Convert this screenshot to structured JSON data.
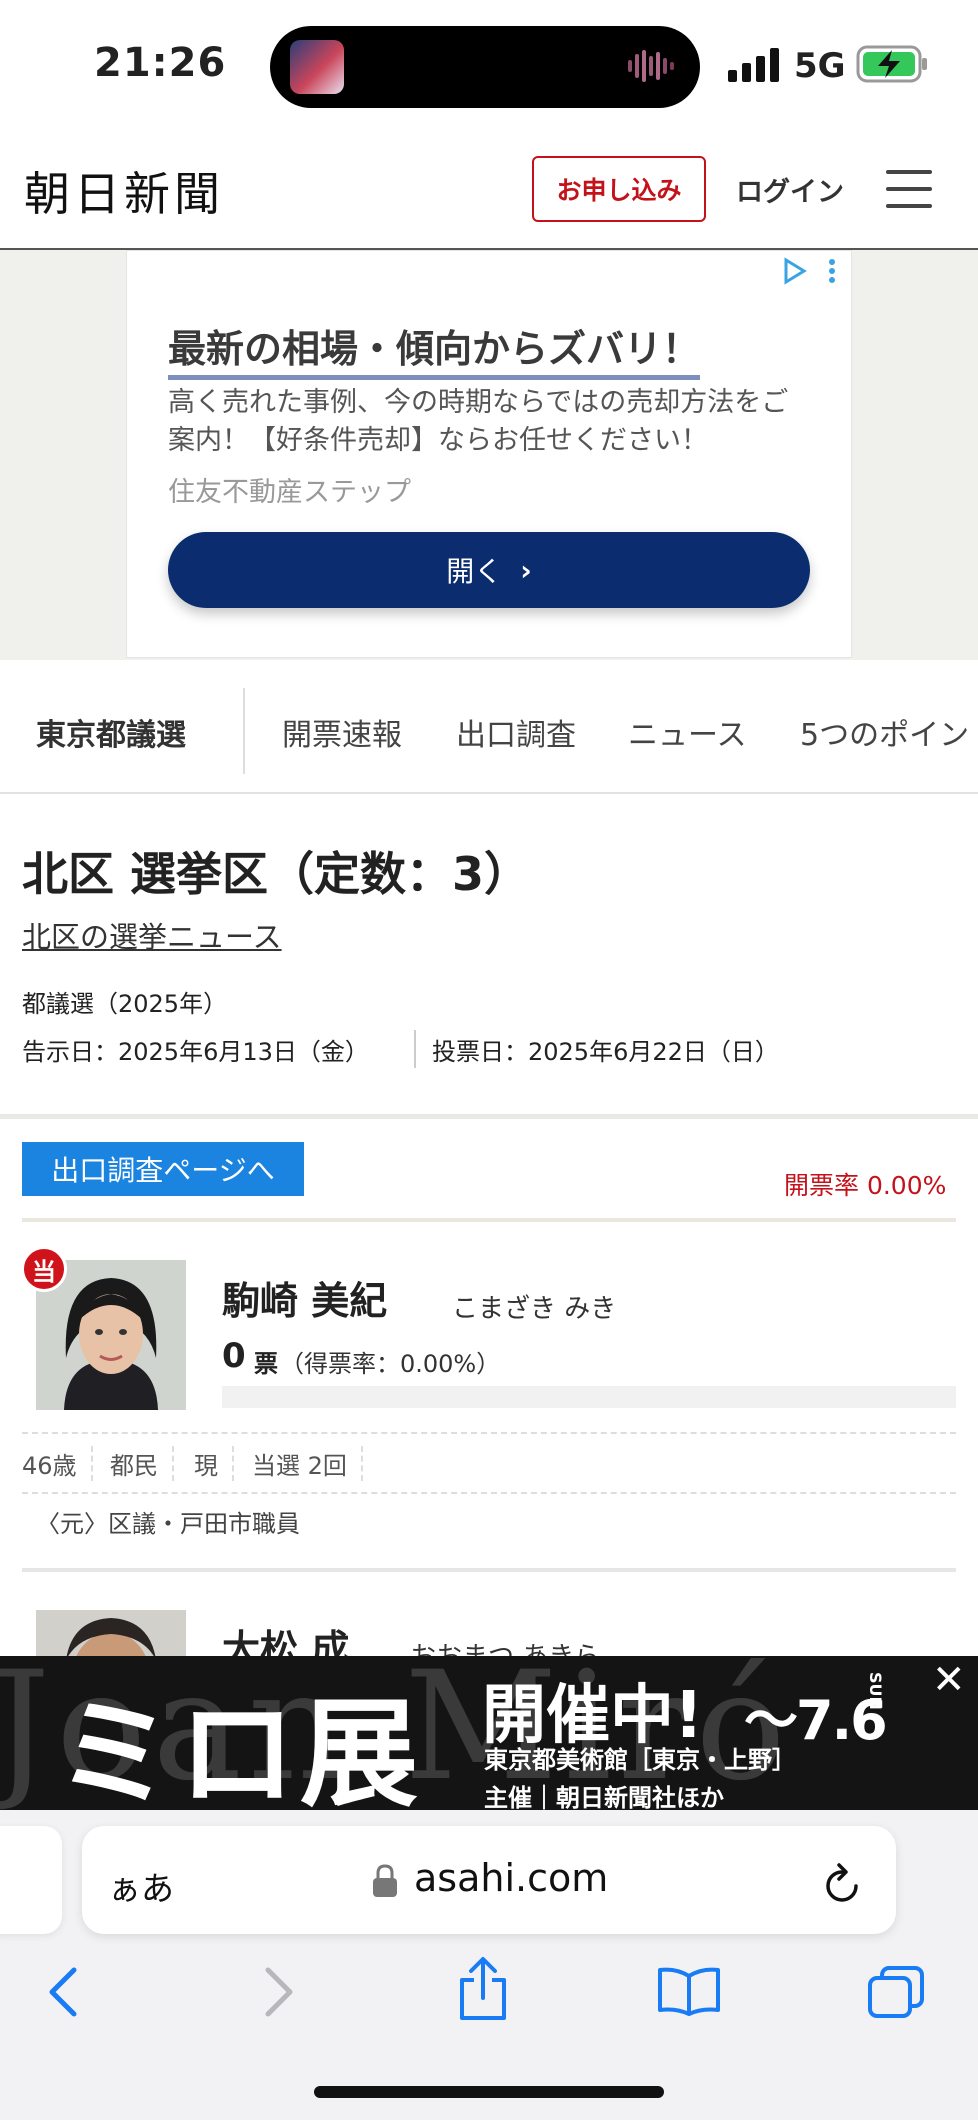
{
  "status_bar": {
    "time": "21:26",
    "network": "5G"
  },
  "header": {
    "logo": "朝日新聞",
    "subscribe_label": "お申し込み",
    "login_label": "ログイン"
  },
  "ad": {
    "headline": "最新の相場・傾向からズバリ！",
    "body": "高く売れた事例、今の時期ならではの売却方法をご案内！【好条件売却】ならお任せください！",
    "advertiser": "住友不動産ステップ",
    "button_label": "開く"
  },
  "election_nav": {
    "title": "東京都議選",
    "tabs": [
      "開票速報",
      "出口調査",
      "ニュース",
      "5つのポイン"
    ]
  },
  "district": {
    "title": "北区 選挙区（定数：3）",
    "news_link": "北区の選挙ニュース",
    "election": "都議選（2025年）",
    "notice_date": "告示日：2025年6月13日（金）",
    "vote_date": "投票日：2025年6月22日（日）"
  },
  "results": {
    "exit_poll_button": "出口調査ページへ",
    "turnout": "開票率 0.00%"
  },
  "candidates": [
    {
      "elected_badge": "当",
      "name": "駒崎 美紀",
      "kana": "こまざき みき",
      "votes": "0",
      "vote_unit": "票",
      "vote_rate": "（得票率：0.00%）",
      "vote_share": 0,
      "tags": [
        "46歳",
        "都民",
        "現",
        "当選 2回"
      ],
      "career": "〈元〉区議・戸田市職員"
    },
    {
      "name": "大松 成",
      "kana": "おおまつ あきら"
    }
  ],
  "banner_ad": {
    "background_letters": "Joan Miró",
    "title": "ミロ展",
    "status": "開催中!",
    "date": "～7.6",
    "day": "SUN",
    "venue": "東京都美術館［東京・上野］",
    "organizer": "主催｜朝日新聞社ほか",
    "close": "✕"
  },
  "browser": {
    "aa_label": "ぁあ",
    "url": "asahi.com"
  },
  "colors": {
    "brand_red": "#c4121b",
    "ad_button": "#0b2d70",
    "exit_poll_blue": "#1b84e0"
  }
}
